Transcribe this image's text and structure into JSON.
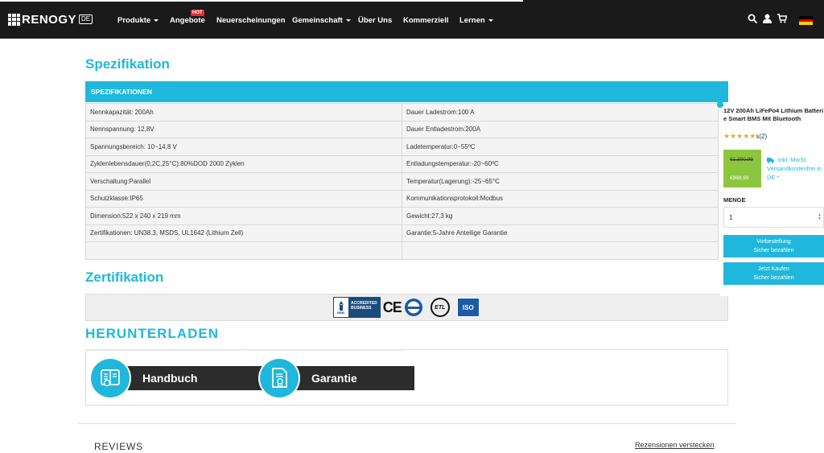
{
  "nav": {
    "logo_text": "RENOGY",
    "logo_badge": "DE",
    "items": [
      {
        "label": "Produkte"
      },
      {
        "label": "Angebote",
        "badge": "HOT"
      },
      {
        "label": "Neuerscheinungen"
      },
      {
        "label": "Gemeinschaft"
      },
      {
        "label": "Über Uns"
      },
      {
        "label": "Kommerziell"
      },
      {
        "label": "Lernen"
      }
    ],
    "icons": [
      "search-icon",
      "user-icon",
      "cart-icon",
      "german-flag-icon"
    ]
  },
  "spec": {
    "title": "Spezifikation",
    "header": "SPEZIFIKATIONEN",
    "rows": [
      [
        "Nennkapazität: 200Ah",
        "Dauer Ladestrom:100 A"
      ],
      [
        "Nennspannung: 12,8V",
        "Dauer Entladestrom:200A"
      ],
      [
        "Spannungsbereich: 10~14,8 V",
        "Ladetemperatur:0~55ºC"
      ],
      [
        "Zyklenlebensdauer(0,2C,25°C):80%DOD 2000 Zyklen",
        "Entladungstemperatur:-20~60ºC"
      ],
      [
        "Verschaltung:Parallel",
        "Temperatur(Lagerung):-25~65°C"
      ],
      [
        "Schutzklasse:IP65",
        "Kommunikationsprotokoll:Modbus"
      ],
      [
        "Dimension:522 x 240 x 219 mm",
        "Gewicht:27,3 kg"
      ],
      [
        "Zertifikationen: UN38.3, MSDS, UL1642 (Lithium Zell)",
        "Garantie:5-Jahre Anteilige Garantie"
      ],
      [
        "",
        ""
      ]
    ]
  },
  "cert": {
    "title": "Zertifikation",
    "bbb_line1": "ACCREDITED",
    "bbb_line2": "BUSINESS",
    "bbb_small": "BBB.",
    "ce": "CE",
    "etl": "ETL",
    "iso": "ISO"
  },
  "download": {
    "title": "HERUNTERLADEN",
    "manual_label": "Handbuch",
    "warranty_label": "Garantie"
  },
  "reviews": {
    "title": "REVIEWS",
    "hide_link": "Rezensionen verstecken"
  },
  "panel": {
    "title_line1": "12V 200Ah LiFePo4 Lithium Batteri",
    "title_line2": "e Smart BMS Mit Bluetooth",
    "stars": "★★★★★",
    "rating_count": "s(2)",
    "rating_value": 5,
    "price_old": "€1.300,99",
    "price_new": "€969,99",
    "tax_line1": "inkl. MwSt.",
    "tax_line2": "Versandkostenfrei in",
    "tax_line3": "DE *",
    "quantity_label": "MENGE",
    "quantity_value": "1",
    "preorder_line1": "Vorbestellung",
    "preorder_line2": "Sicher bezahlen",
    "buy_line1": "Jetzt Kaufen",
    "buy_line2": "Sicher bezahlen"
  },
  "colors": {
    "accent": "#1fb8dc",
    "nav_bg": "#1a1a1a",
    "price_bg": "#8cc63f",
    "hot_badge": "#e52d2d"
  }
}
